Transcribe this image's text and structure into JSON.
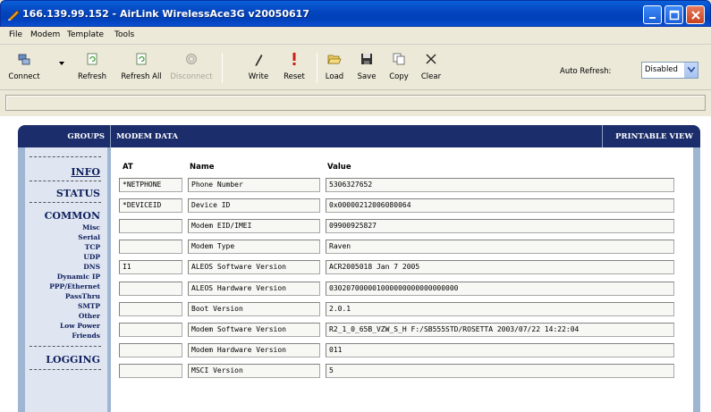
{
  "window": {
    "title": "166.139.99.152 - AirLink WirelessAce3G v20050617"
  },
  "menu": [
    "File",
    "Modem",
    "Template",
    "Tools"
  ],
  "toolbar": {
    "buttons": [
      {
        "label": "Connect",
        "icon": "connect-icon",
        "enabled": true
      },
      {
        "label": "Refresh",
        "icon": "refresh-icon",
        "enabled": true
      },
      {
        "label": "Refresh All",
        "icon": "refresh-all-icon",
        "enabled": true
      },
      {
        "label": "Disconnect",
        "icon": "disconnect-icon",
        "enabled": false
      },
      {
        "label": "Write",
        "icon": "pencil-icon",
        "enabled": true
      },
      {
        "label": "Reset",
        "icon": "exclamation-icon",
        "enabled": true
      },
      {
        "label": "Load",
        "icon": "folder-open-icon",
        "enabled": true
      },
      {
        "label": "Save",
        "icon": "floppy-disk-icon",
        "enabled": true
      },
      {
        "label": "Copy",
        "icon": "copy-icon",
        "enabled": true
      },
      {
        "label": "Clear",
        "icon": "x-icon",
        "enabled": true
      }
    ],
    "auto_refresh_label": "Auto Refresh:",
    "auto_refresh_value": "Disabled"
  },
  "panel": {
    "groups_header": "GROUPS",
    "modem_data_header": "MODEM DATA",
    "printable_view": "PRINTABLE VIEW"
  },
  "sidebar": {
    "sections": [
      {
        "label": "INFO",
        "link": true,
        "items": []
      },
      {
        "label": "STATUS",
        "link": false,
        "items": []
      },
      {
        "label": "COMMON",
        "link": false,
        "items": [
          "Misc",
          "Serial",
          "TCP",
          "UDP",
          "DNS",
          "Dynamic IP",
          "PPP/Ethernet",
          "PassThru",
          "SMTP",
          "Other",
          "Low Power",
          "Friends"
        ]
      },
      {
        "label": "LOGGING",
        "link": false,
        "items": []
      }
    ]
  },
  "table": {
    "headers": {
      "at": "AT",
      "name": "Name",
      "value": "Value"
    },
    "rows": [
      {
        "at": "*NETPHONE",
        "name": "Phone Number",
        "value": "5306327652"
      },
      {
        "at": "*DEVICEID",
        "name": "Device ID",
        "value": "0x00000212006080064"
      },
      {
        "at": "",
        "name": "Modem EID/IMEI",
        "value": "09900925827"
      },
      {
        "at": "",
        "name": "Modem Type",
        "value": "Raven"
      },
      {
        "at": "I1",
        "name": "ALEOS Software Version",
        "value": "ACR2005018 Jan 7 2005"
      },
      {
        "at": "",
        "name": "ALEOS Hardware Version",
        "value": "030207000001000000000000000000"
      },
      {
        "at": "",
        "name": "Boot Version",
        "value": "2.0.1"
      },
      {
        "at": "",
        "name": "Modem Software Version",
        "value": "R2_1_0_65B_VZW_S_H F:/SB555STD/ROSETTA 2003/07/22 14:22:04"
      },
      {
        "at": "",
        "name": "Modem Hardware Version",
        "value": "011"
      },
      {
        "at": "",
        "name": "MSCI Version",
        "value": "5"
      }
    ]
  }
}
